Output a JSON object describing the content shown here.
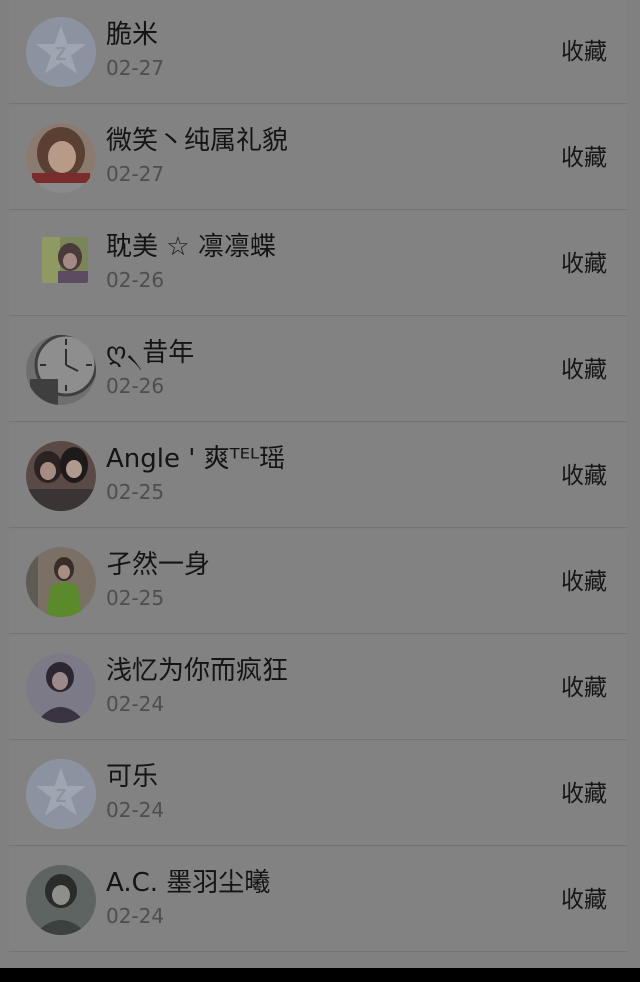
{
  "contacts": [
    {
      "name": "脆米",
      "date": "02-27",
      "action": "收藏",
      "avatar": "default-avatar-icon"
    },
    {
      "name": "微笑丶纯属礼貌",
      "date": "02-27",
      "action": "收藏",
      "avatar": "photo-avatar"
    },
    {
      "name": "耽美 ☆ 凛凛蝶",
      "date": "02-26",
      "action": "收藏",
      "avatar": "photo-avatar"
    },
    {
      "name": "ღ৲昔年",
      "date": "02-26",
      "action": "收藏",
      "avatar": "clock-photo-avatar"
    },
    {
      "name": "Angle ' 爽ᵀᴱᴸ瑶",
      "date": "02-25",
      "action": "收藏",
      "avatar": "photo-avatar"
    },
    {
      "name": "孑然一身",
      "date": "02-25",
      "action": "收藏",
      "avatar": "photo-avatar"
    },
    {
      "name": "浅忆为你而疯狂",
      "date": "02-24",
      "action": "收藏",
      "avatar": "photo-avatar"
    },
    {
      "name": "可乐",
      "date": "02-24",
      "action": "收藏",
      "avatar": "default-avatar-icon"
    },
    {
      "name": "A.C. 墨羽尘曦",
      "date": "02-24",
      "action": "收藏",
      "avatar": "photo-avatar"
    }
  ],
  "colors": {
    "background": "#808080",
    "text": "#141414",
    "subtext": "#4e4e4e"
  }
}
